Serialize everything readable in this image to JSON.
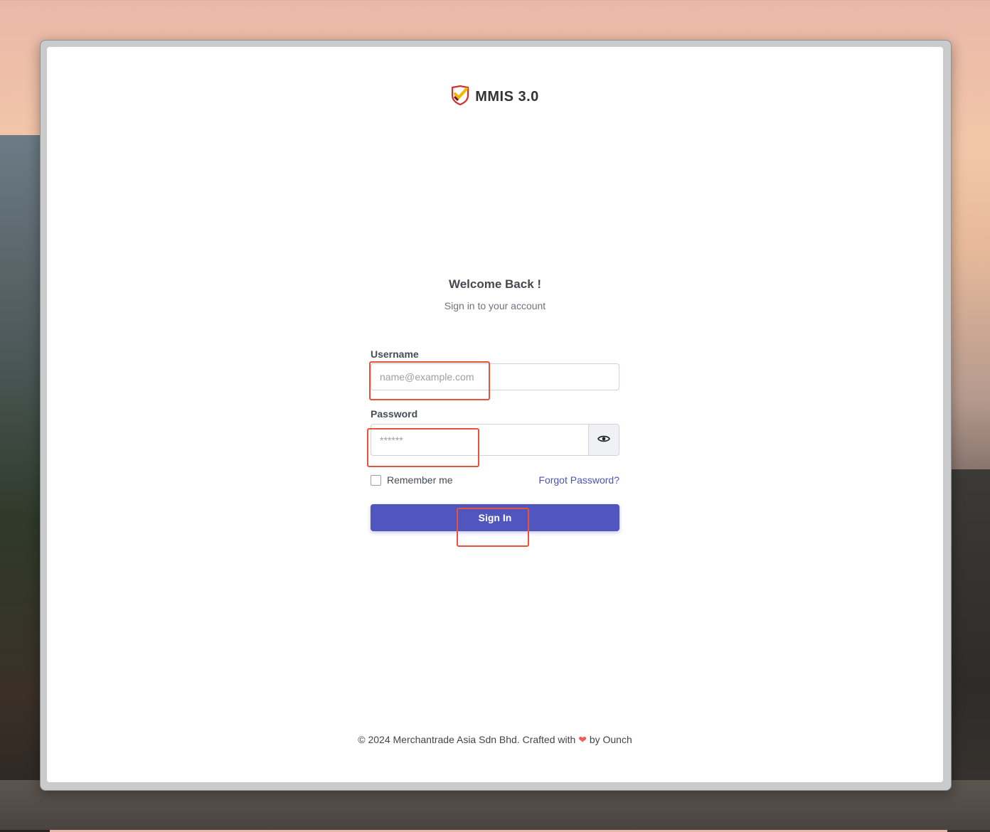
{
  "brand": {
    "name": "MMIS 3.0",
    "logo_icon": "shield-check-icon"
  },
  "welcome": {
    "title": "Welcome Back !",
    "subtitle": "Sign in to your account"
  },
  "form": {
    "username_label": "Username",
    "username_placeholder": "name@example.com",
    "password_label": "Password",
    "password_placeholder": "******",
    "toggle_icon": "eye-icon",
    "remember_label": "Remember me",
    "forgot_label": "Forgot Password?",
    "signin_label": "Sign In"
  },
  "footer": {
    "before_heart": "© 2024 Merchantrade Asia Sdn Bhd. Crafted with",
    "heart": "❤",
    "after_heart": "by Ounch"
  },
  "colors": {
    "primary": "#5156be",
    "link": "#4d52b8",
    "highlight": "#e8533a",
    "heart": "#f05a5a"
  }
}
